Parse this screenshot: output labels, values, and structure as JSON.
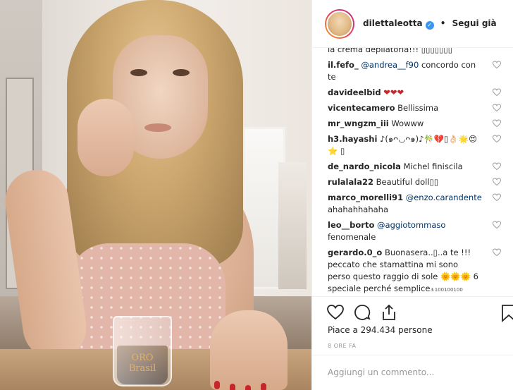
{
  "post": {
    "author": "dilettaleotta",
    "follow_label": "Segui già",
    "separator": "•",
    "verified_mark": "✓"
  },
  "comments": [
    {
      "user": "",
      "text": "la crema depilatoria!!! ▯▯▯▯▯▯▯"
    },
    {
      "user": "il.fefo_",
      "mention": "@andrea__f90",
      "text": " concordo con te"
    },
    {
      "user": "davideelbid",
      "text": " ❤❤❤",
      "text_color": "#c7242b"
    },
    {
      "user": "vicentecamero",
      "text": " Bellissima"
    },
    {
      "user": "mr_wngzm_iii",
      "text": " Wowww"
    },
    {
      "user": "h3.hayashi",
      "text": " ♪(๑ᴖ◡ᴖ๑)♪🎋💔▯👌🏻🌟😍⭐ ▯"
    },
    {
      "user": "de_nardo_nicola",
      "text": " Michel finiscila"
    },
    {
      "user": "rulalala22",
      "text": " Beautiful doll▯▯"
    },
    {
      "user": "marco_morelli91",
      "mention": "@enzo.carandente",
      "text": " ahahahhahaha"
    },
    {
      "user": "leo__borto",
      "mention": "@aggiotommaso",
      "text": " fenomenale"
    },
    {
      "user": "gerardo.0_o",
      "text": " Buonasera..▯..a te !!! peccato che stamattina mi sono perso questo raggio di sole 🌞🌞🌞 6 speciale perché semplice",
      "tag": "⚓100100100"
    }
  ],
  "actions": {
    "likes_text": "Piace a 294.434 persone",
    "time_ago": "8 ORE FA",
    "add_comment_placeholder": "Aggiungi un commento..."
  },
  "icons": {
    "like": "heart-icon",
    "comment": "comment-icon",
    "share": "share-icon",
    "save": "bookmark-icon"
  },
  "photo": {
    "cup_logo": "ORO Brasil"
  },
  "colors": {
    "mention": "#003569",
    "verified": "#3897f0",
    "muted": "#999999"
  }
}
